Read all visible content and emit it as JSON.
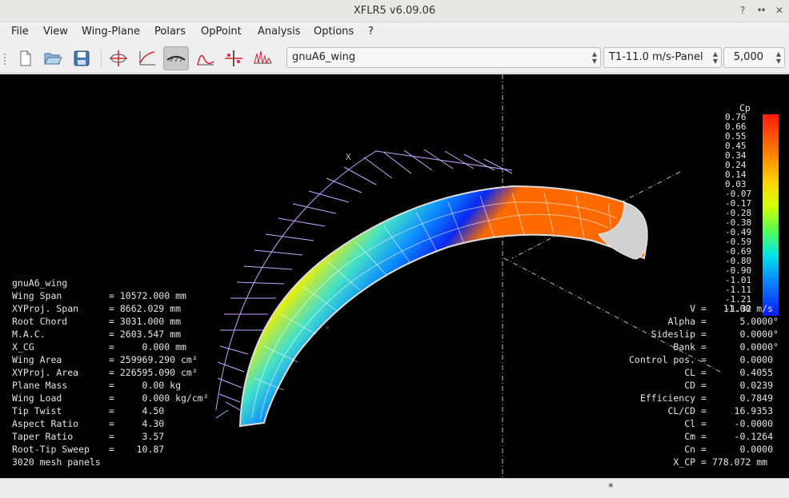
{
  "window": {
    "title": "XFLR5 v6.09.06",
    "buttons": [
      "?",
      "•",
      "•",
      "✕"
    ]
  },
  "menu": [
    "File",
    "View",
    "Wing-Plane",
    "Polars",
    "OpPoint",
    "Analysis",
    "Options",
    "?"
  ],
  "toolbar": {
    "icons": [
      "new-file-icon",
      "open-folder-icon",
      "save-icon",
      "airfoil-design-icon",
      "xdirect-icon",
      "wing-design-icon",
      "cp-graph-icon",
      "stability-icon",
      "spectrum-icon"
    ],
    "plane": "gnuA6_wing",
    "polar": "T1-11.0 m/s-Panel",
    "opp": "5,000"
  },
  "colors": {
    "viewport": "#000000",
    "wing_outline": "#c8a6ff"
  },
  "view": {
    "axis_label": "X",
    "marker": "*",
    "legend": {
      "title": "Cp",
      "values": [
        "0.76",
        "0.66",
        "0.55",
        "0.45",
        "0.34",
        "0.24",
        "0.14",
        "0.03",
        "-0.07",
        "-0.17",
        "-0.28",
        "-0.38",
        "-0.49",
        "-0.59",
        "-0.69",
        "-0.80",
        "-0.90",
        "-1.01",
        "-1.11",
        "-1.21",
        "-1.32"
      ]
    },
    "wing_name": "gnuA6_wing",
    "wing_props": [
      {
        "label": "Wing Span",
        "value": "= 10572.000 mm"
      },
      {
        "label": "XYProj. Span",
        "value": "= 8662.029 mm"
      },
      {
        "label": "Root Chord",
        "value": "= 3031.000 mm"
      },
      {
        "label": "M.A.C.",
        "value": "= 2603.547 mm"
      },
      {
        "label": "X_CG",
        "value": "=     0.000 mm"
      },
      {
        "label": "Wing Area",
        "value": "= 259969.290 cm²"
      },
      {
        "label": "XYProj. Area",
        "value": "= 226595.090 cm²"
      },
      {
        "label": "Plane Mass",
        "value": "=     0.00 kg"
      },
      {
        "label": "Wing Load",
        "value": "=     0.000 kg/cm²"
      },
      {
        "label": "Tip Twist",
        "value": "=     4.50"
      },
      {
        "label": "Aspect Ratio",
        "value": "=     4.30"
      },
      {
        "label": "Taper Ratio",
        "value": "=     3.57"
      },
      {
        "label": "Root-Tip Sweep",
        "value": "=    10.87"
      }
    ],
    "mesh": "3020 mesh panels",
    "opp_props": [
      {
        "label": "V",
        "value": "=   11.00 m/s"
      },
      {
        "label": "Alpha",
        "value": "=      5.0000°"
      },
      {
        "label": "Sideslip",
        "value": "=      0.0000°"
      },
      {
        "label": "Bank",
        "value": "=      0.0000°"
      },
      {
        "label": "Control pos.",
        "value": "=      0.0000"
      },
      {
        "label": "CL",
        "value": "=      0.4055"
      },
      {
        "label": "CD",
        "value": "=      0.0239"
      },
      {
        "label": "Efficiency",
        "value": "=      0.7849"
      },
      {
        "label": "CL/CD",
        "value": "=     16.9353"
      },
      {
        "label": "Cl",
        "value": "=     -0.0000"
      },
      {
        "label": "Cm",
        "value": "=     -0.1264"
      },
      {
        "label": "Cn",
        "value": "=      0.0000"
      },
      {
        "label": "X_CP",
        "value": "= 778.072 mm"
      }
    ]
  },
  "status": {
    "text": "*"
  }
}
